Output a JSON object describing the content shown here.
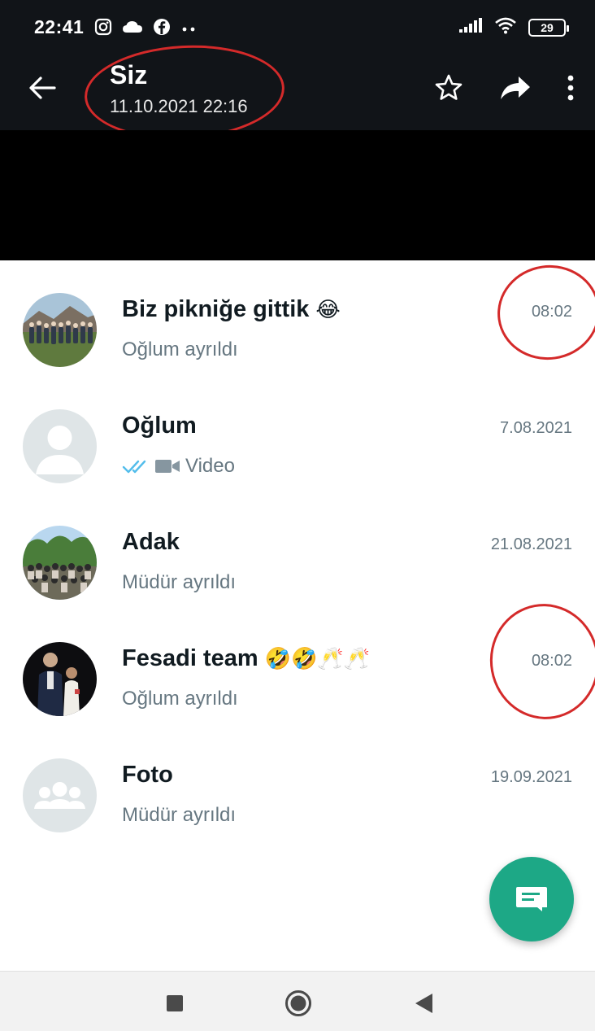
{
  "status_bar": {
    "time": "22:41",
    "battery": "29",
    "left_icons": [
      "instagram-icon",
      "cloud-icon",
      "facebook-icon",
      "more-dots-icon"
    ],
    "right_icons": [
      "signal-icon",
      "wifi-icon",
      "battery-icon"
    ]
  },
  "header": {
    "title": "Siz",
    "subtitle": "11.10.2021 22:16",
    "actions": [
      "star-icon",
      "forward-icon",
      "more-vert-icon"
    ]
  },
  "chats": [
    {
      "name": "Biz pikniğe gittik",
      "name_emoji": "😂",
      "subtitle": "Oğlum ayrıldı",
      "time": "08:02",
      "avatar": "photo-outdoor-group"
    },
    {
      "name": "Oğlum",
      "name_emoji": "",
      "subtitle": "Video",
      "time": "7.08.2021",
      "avatar": "default-person"
    },
    {
      "name": "Adak",
      "name_emoji": "",
      "subtitle": "Müdür ayrıldı",
      "time": "21.08.2021",
      "avatar": "photo-large-group"
    },
    {
      "name": "Fesadi team",
      "name_emoji": "🤣🤣🥂🥂",
      "subtitle": "Oğlum ayrıldı",
      "time": "08:02",
      "avatar": "photo-couple"
    },
    {
      "name": "Foto",
      "name_emoji": "",
      "subtitle": "Müdür ayrıldı",
      "time": "19.09.2021",
      "avatar": "default-group"
    }
  ],
  "colors": {
    "header_bg": "#111418",
    "accent": "#1da886",
    "read_ticks": "#53bdeb",
    "annotation": "#d42a2a"
  }
}
